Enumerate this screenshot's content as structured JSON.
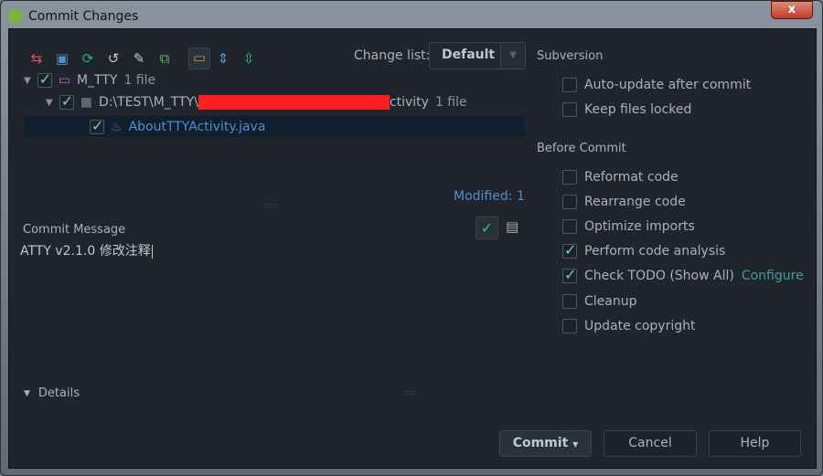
{
  "window": {
    "title": "Commit Changes",
    "close_label": "x"
  },
  "toolbar": {
    "change_list_label": "Change list:",
    "change_list_value": "Default"
  },
  "tree": [
    {
      "label": "M_TTY",
      "count": "1 file"
    },
    {
      "label": "D:\\TEST\\M_TTY\\",
      "suffix": "ctivity",
      "count": "1 file"
    },
    {
      "label": "AboutTTYActivity.java"
    }
  ],
  "modified": "Modified: 1",
  "commit_message": {
    "label": "Commit Message",
    "value": "ATTY v2.1.0 修改注释"
  },
  "details_label": "Details",
  "subversion": {
    "title": "Subversion",
    "options": [
      {
        "label": "Auto-update after commit",
        "checked": false
      },
      {
        "label": "Keep files locked",
        "checked": false
      }
    ]
  },
  "before_commit": {
    "title": "Before Commit",
    "options": [
      {
        "label": "Reformat code",
        "checked": false
      },
      {
        "label": "Rearrange code",
        "checked": false
      },
      {
        "label": "Optimize imports",
        "checked": false
      },
      {
        "label": "Perform code analysis",
        "checked": true
      },
      {
        "label": "Check TODO (Show All)",
        "checked": true,
        "link": "Configure"
      },
      {
        "label": "Cleanup",
        "checked": false
      },
      {
        "label": "Update copyright",
        "checked": false
      }
    ]
  },
  "buttons": {
    "commit": "Commit",
    "cancel": "Cancel",
    "help": "Help"
  }
}
